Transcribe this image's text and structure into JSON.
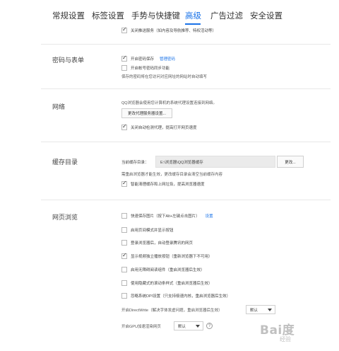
{
  "tabs": [
    {
      "label": "常规设置"
    },
    {
      "label": "标签设置"
    },
    {
      "label": "手势与快捷键"
    },
    {
      "label": "高级"
    },
    {
      "label": "广告过滤"
    },
    {
      "label": "安全设置"
    }
  ],
  "active_tab": "高级",
  "top_option": {
    "label": "关闭推送服务（如内容及导航推荐、特权活动等）",
    "checked": true
  },
  "password": {
    "title": "密码与表单",
    "save_password": {
      "label": "开启密码保存",
      "checked": true,
      "link": "管理密码"
    },
    "sync": {
      "label": "开启帐号密码同步功能",
      "checked": false
    },
    "note": "保存的密码将在您访问对应网址的网站时自动填写"
  },
  "network": {
    "title": "网络",
    "description": "QQ浏览器会使用您计算机的系统代理设置连接到网络。",
    "proxy_button": "更改代理服务器设置...",
    "auto_detect": {
      "label": "关闭自动检测代理，提高打开网页速度",
      "checked": true
    }
  },
  "cache": {
    "title": "缓存目录",
    "path_label": "当前缓存目录：",
    "path_value": "E:\\浏览器\\QQ浏览器缓存",
    "change_button": "更改...",
    "note": "需重启浏览器才能生效，更改缓存目录会清空当前缓存内容",
    "smart_clean": {
      "label": "智能清理缓存和上网垃圾，提高浏览器速度",
      "checked": true
    }
  },
  "browsing": {
    "title": "网页浏览",
    "options": [
      {
        "label": "快速保存图片（按下Alt+左键点击图片）",
        "checked": false,
        "link": "设置"
      },
      {
        "label": "启用页间模式并显示按钮",
        "checked": false
      },
      {
        "label": "登录浏览器后，自动登录腾讯的网页",
        "checked": false
      },
      {
        "label": "显示视频独立播放按钮（重新浏览器下不可用）",
        "checked": true
      },
      {
        "label": "启用无障碍阅读组件（重启浏览器后生效）",
        "checked": false
      },
      {
        "label": "使用隐藏式的滚动条样式（重启浏览器后生效）",
        "checked": false
      },
      {
        "label": "忽略系统DPI设置（只支持极速内核，重启浏览器后生效）",
        "checked": false
      }
    ],
    "directwrite": {
      "label": "开启DirectWrite（解决字体发虚问题，重启浏览器后生效）",
      "value": "默认"
    },
    "gpu": {
      "label": "开启GPU加速渲染网页",
      "value": "默认",
      "help": "?"
    }
  },
  "watermark": {
    "text": "Bai度",
    "sub": "经验"
  }
}
